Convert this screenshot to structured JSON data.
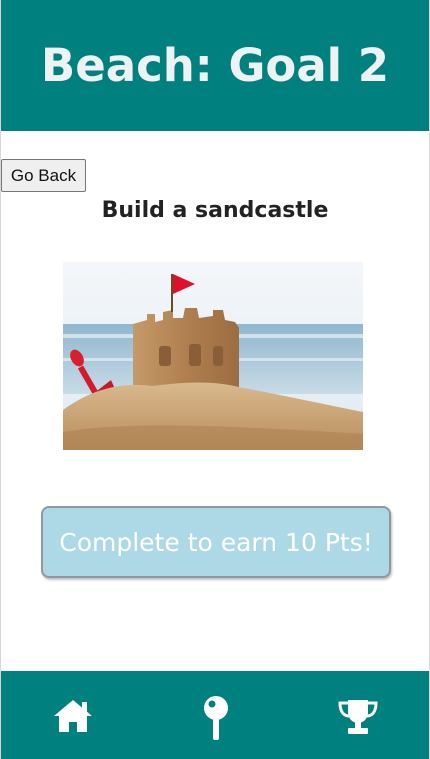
{
  "header": {
    "title": "Beach: Goal 2"
  },
  "nav": {
    "back_label": "Go Back"
  },
  "goal": {
    "title": "Build a sandcastle",
    "complete_label": "Complete to earn 10 Pts!"
  },
  "footer": {
    "icons": [
      "home-icon",
      "map-pin-icon",
      "trophy-icon"
    ]
  },
  "colors": {
    "brand": "#00817f",
    "button_bg": "#add8e6",
    "header_text": "#eef2f2"
  }
}
